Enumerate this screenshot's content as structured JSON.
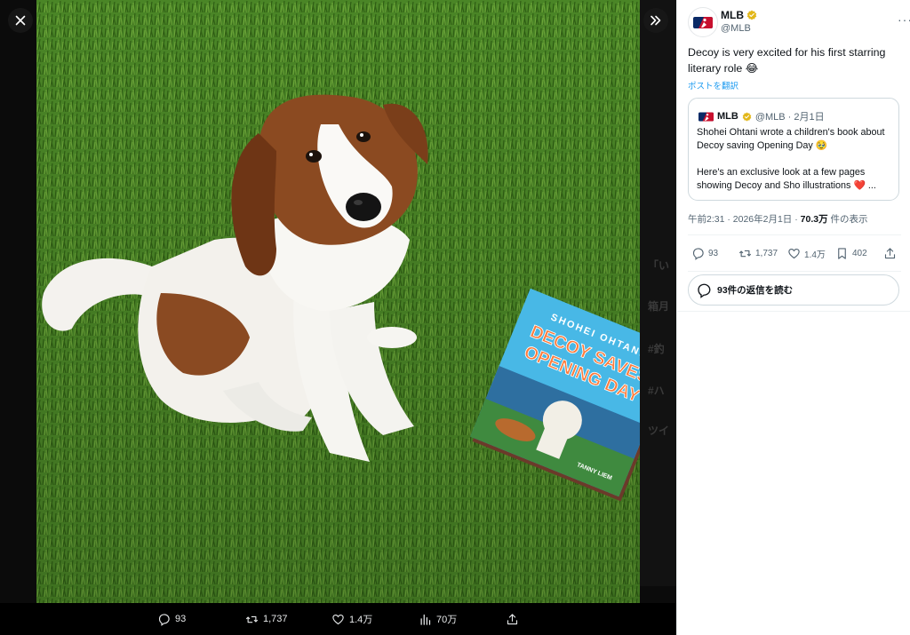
{
  "viewer": {
    "book": {
      "author": "SHOHEI OHTANI",
      "title_line1": "DECOY SAVES",
      "title_line2": "OPENING DAY",
      "illustrator": "TANNY LIEM"
    },
    "bottom_bar": {
      "replies": "93",
      "reposts": "1,737",
      "likes": "1.4万",
      "views": "70万"
    }
  },
  "tweet": {
    "author_name": "MLB",
    "author_handle": "@MLB",
    "text": "Decoy is very excited for his first starring literary role 😂",
    "translate": "ポストを翻訳",
    "quote": {
      "name": "MLB",
      "handle_date": "@MLB · 2月1日",
      "text_p1": "Shohei Ohtani wrote a children's book about Decoy saving Opening Day 🥹",
      "text_p2": "Here's an exclusive look at a few pages showing Decoy and Sho illustrations ❤️ ..."
    },
    "timestamp": "午前2:31 · 2026年2月1日 · ",
    "views_count": "70.3万",
    "views_suffix": " 件の表示",
    "actions": {
      "replies": "93",
      "reposts": "1,737",
      "likes": "1.4万",
      "bookmarks": "402"
    },
    "read_replies": "93件の返信を読む"
  },
  "colors": {
    "accent": "#1d9bf0",
    "verified": "#e2b719",
    "text": "#0f1419",
    "secondary": "#536471",
    "grass": "#3f7a1f"
  }
}
